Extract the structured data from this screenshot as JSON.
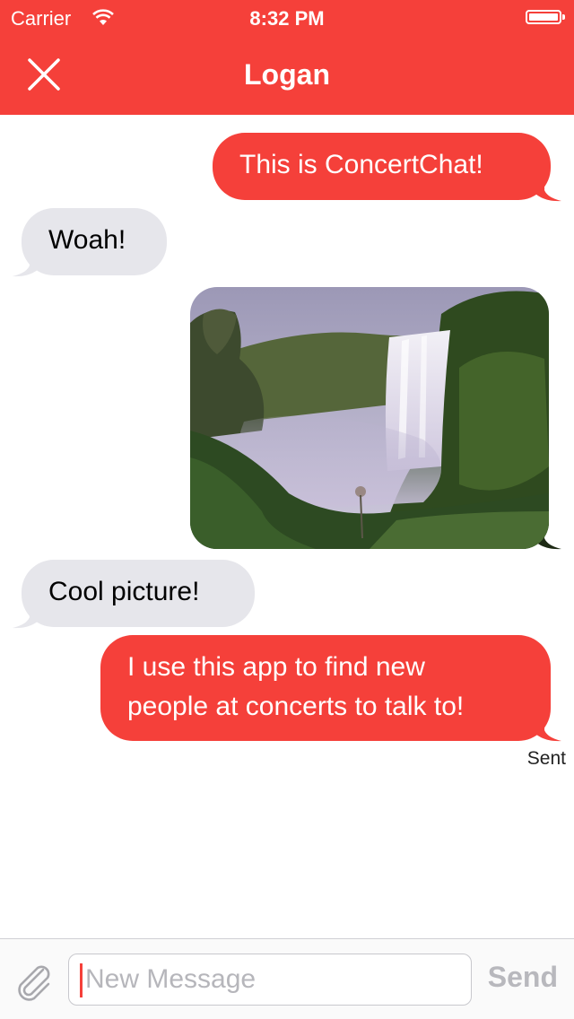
{
  "status_bar": {
    "carrier": "Carrier",
    "time": "8:32 PM"
  },
  "nav": {
    "title": "Logan",
    "close_icon": "close-x-icon"
  },
  "messages": [
    {
      "direction": "outgoing",
      "type": "text",
      "text": "This is ConcertChat!"
    },
    {
      "direction": "incoming",
      "type": "text",
      "text": "Woah!"
    },
    {
      "direction": "outgoing",
      "type": "image",
      "image": "waterfall-landscape-photo"
    },
    {
      "direction": "incoming",
      "type": "text",
      "text": "Cool picture!"
    },
    {
      "direction": "outgoing",
      "type": "text",
      "lines": [
        "I use this app to find new",
        "people at concerts to talk to!"
      ]
    }
  ],
  "delivery_status": "Sent",
  "composer": {
    "placeholder": "New Message",
    "send_label": "Send",
    "attach_icon": "paperclip-icon"
  },
  "colors": {
    "accent": "#f5403a",
    "incoming_bubble": "#e6e6eb",
    "send_disabled": "#b8b8bd"
  }
}
